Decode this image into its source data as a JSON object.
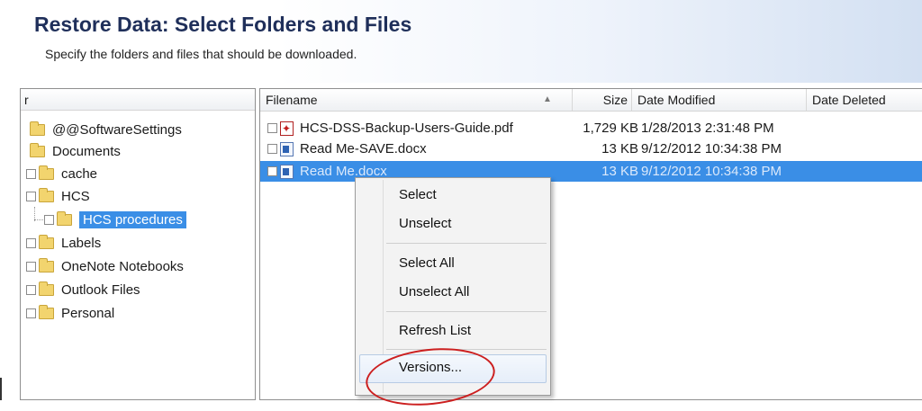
{
  "header": {
    "title": "Restore Data: Select Folders and Files",
    "subtitle": "Specify the folders and files that should be downloaded."
  },
  "folder_tree": {
    "header_label": "r",
    "items": [
      {
        "label": "@@SoftwareSettings",
        "checkbox": false
      },
      {
        "label": "Documents",
        "checkbox": false
      },
      {
        "label": "cache",
        "checkbox": true
      },
      {
        "label": "HCS",
        "checkbox": true
      },
      {
        "label": "HCS procedures",
        "checkbox": true,
        "selected": true
      },
      {
        "label": "Labels",
        "checkbox": true
      },
      {
        "label": "OneNote Notebooks",
        "checkbox": true
      },
      {
        "label": "Outlook Files",
        "checkbox": true
      },
      {
        "label": "Personal",
        "checkbox": true
      }
    ]
  },
  "file_list": {
    "columns": {
      "filename": "Filename",
      "size": "Size",
      "date_modified": "Date Modified",
      "date_deleted": "Date Deleted"
    },
    "rows": [
      {
        "name": "HCS-DSS-Backup-Users-Guide.pdf",
        "size": "1,729 KB",
        "modified": "1/28/2013 2:31:48 PM",
        "icon": "pdf-icon"
      },
      {
        "name": "Read Me-SAVE.docx",
        "size": "13 KB",
        "modified": "9/12/2012 10:34:38 PM",
        "icon": "word-doc-icon"
      },
      {
        "name": "Read Me.docx",
        "size": "13 KB",
        "modified": "9/12/2012 10:34:38 PM",
        "icon": "word-doc-icon",
        "selected": true
      }
    ]
  },
  "context_menu": {
    "select": "Select",
    "unselect": "Unselect",
    "select_all": "Select All",
    "unselect_all": "Unselect All",
    "refresh_list": "Refresh List",
    "versions": "Versions..."
  },
  "colors": {
    "selection": "#3a8ee6",
    "title": "#1f2f5a",
    "annotation": "#cc1f1f"
  }
}
